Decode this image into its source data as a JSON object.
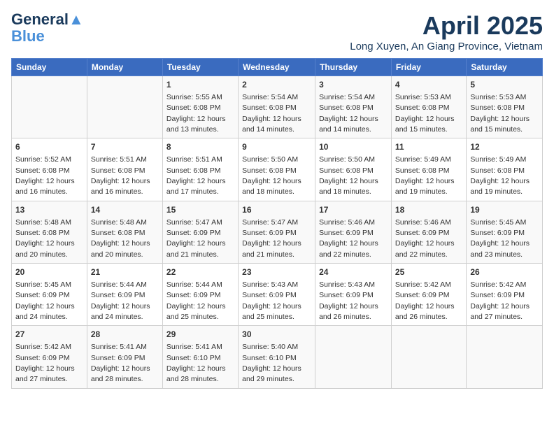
{
  "logo": {
    "line1": "General",
    "line2": "Blue"
  },
  "title": "April 2025",
  "subtitle": "Long Xuyen, An Giang Province, Vietnam",
  "days_of_week": [
    "Sunday",
    "Monday",
    "Tuesday",
    "Wednesday",
    "Thursday",
    "Friday",
    "Saturday"
  ],
  "weeks": [
    [
      {
        "day": "",
        "info": ""
      },
      {
        "day": "",
        "info": ""
      },
      {
        "day": "1",
        "info": "Sunrise: 5:55 AM\nSunset: 6:08 PM\nDaylight: 12 hours and 13 minutes."
      },
      {
        "day": "2",
        "info": "Sunrise: 5:54 AM\nSunset: 6:08 PM\nDaylight: 12 hours and 14 minutes."
      },
      {
        "day": "3",
        "info": "Sunrise: 5:54 AM\nSunset: 6:08 PM\nDaylight: 12 hours and 14 minutes."
      },
      {
        "day": "4",
        "info": "Sunrise: 5:53 AM\nSunset: 6:08 PM\nDaylight: 12 hours and 15 minutes."
      },
      {
        "day": "5",
        "info": "Sunrise: 5:53 AM\nSunset: 6:08 PM\nDaylight: 12 hours and 15 minutes."
      }
    ],
    [
      {
        "day": "6",
        "info": "Sunrise: 5:52 AM\nSunset: 6:08 PM\nDaylight: 12 hours and 16 minutes."
      },
      {
        "day": "7",
        "info": "Sunrise: 5:51 AM\nSunset: 6:08 PM\nDaylight: 12 hours and 16 minutes."
      },
      {
        "day": "8",
        "info": "Sunrise: 5:51 AM\nSunset: 6:08 PM\nDaylight: 12 hours and 17 minutes."
      },
      {
        "day": "9",
        "info": "Sunrise: 5:50 AM\nSunset: 6:08 PM\nDaylight: 12 hours and 18 minutes."
      },
      {
        "day": "10",
        "info": "Sunrise: 5:50 AM\nSunset: 6:08 PM\nDaylight: 12 hours and 18 minutes."
      },
      {
        "day": "11",
        "info": "Sunrise: 5:49 AM\nSunset: 6:08 PM\nDaylight: 12 hours and 19 minutes."
      },
      {
        "day": "12",
        "info": "Sunrise: 5:49 AM\nSunset: 6:08 PM\nDaylight: 12 hours and 19 minutes."
      }
    ],
    [
      {
        "day": "13",
        "info": "Sunrise: 5:48 AM\nSunset: 6:08 PM\nDaylight: 12 hours and 20 minutes."
      },
      {
        "day": "14",
        "info": "Sunrise: 5:48 AM\nSunset: 6:08 PM\nDaylight: 12 hours and 20 minutes."
      },
      {
        "day": "15",
        "info": "Sunrise: 5:47 AM\nSunset: 6:09 PM\nDaylight: 12 hours and 21 minutes."
      },
      {
        "day": "16",
        "info": "Sunrise: 5:47 AM\nSunset: 6:09 PM\nDaylight: 12 hours and 21 minutes."
      },
      {
        "day": "17",
        "info": "Sunrise: 5:46 AM\nSunset: 6:09 PM\nDaylight: 12 hours and 22 minutes."
      },
      {
        "day": "18",
        "info": "Sunrise: 5:46 AM\nSunset: 6:09 PM\nDaylight: 12 hours and 22 minutes."
      },
      {
        "day": "19",
        "info": "Sunrise: 5:45 AM\nSunset: 6:09 PM\nDaylight: 12 hours and 23 minutes."
      }
    ],
    [
      {
        "day": "20",
        "info": "Sunrise: 5:45 AM\nSunset: 6:09 PM\nDaylight: 12 hours and 24 minutes."
      },
      {
        "day": "21",
        "info": "Sunrise: 5:44 AM\nSunset: 6:09 PM\nDaylight: 12 hours and 24 minutes."
      },
      {
        "day": "22",
        "info": "Sunrise: 5:44 AM\nSunset: 6:09 PM\nDaylight: 12 hours and 25 minutes."
      },
      {
        "day": "23",
        "info": "Sunrise: 5:43 AM\nSunset: 6:09 PM\nDaylight: 12 hours and 25 minutes."
      },
      {
        "day": "24",
        "info": "Sunrise: 5:43 AM\nSunset: 6:09 PM\nDaylight: 12 hours and 26 minutes."
      },
      {
        "day": "25",
        "info": "Sunrise: 5:42 AM\nSunset: 6:09 PM\nDaylight: 12 hours and 26 minutes."
      },
      {
        "day": "26",
        "info": "Sunrise: 5:42 AM\nSunset: 6:09 PM\nDaylight: 12 hours and 27 minutes."
      }
    ],
    [
      {
        "day": "27",
        "info": "Sunrise: 5:42 AM\nSunset: 6:09 PM\nDaylight: 12 hours and 27 minutes."
      },
      {
        "day": "28",
        "info": "Sunrise: 5:41 AM\nSunset: 6:09 PM\nDaylight: 12 hours and 28 minutes."
      },
      {
        "day": "29",
        "info": "Sunrise: 5:41 AM\nSunset: 6:10 PM\nDaylight: 12 hours and 28 minutes."
      },
      {
        "day": "30",
        "info": "Sunrise: 5:40 AM\nSunset: 6:10 PM\nDaylight: 12 hours and 29 minutes."
      },
      {
        "day": "",
        "info": ""
      },
      {
        "day": "",
        "info": ""
      },
      {
        "day": "",
        "info": ""
      }
    ]
  ]
}
